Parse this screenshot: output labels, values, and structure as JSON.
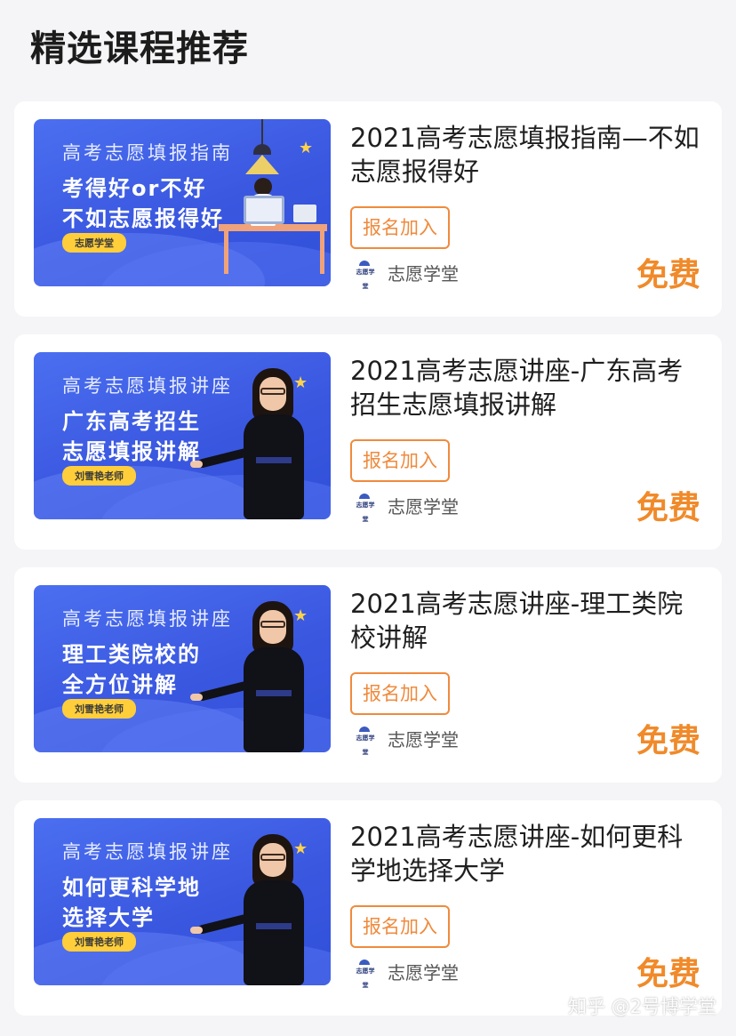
{
  "section_title": "精选课程推荐",
  "courses": [
    {
      "title": "2021高考志愿填报指南—不如志愿报得好",
      "join_label": "报名加入",
      "org_logo_text": "志愿学堂",
      "org_name": "志愿学堂",
      "price": "免费",
      "thumb": {
        "line1": "高考志愿填报指南",
        "line2": "考得好or不好",
        "line3": "不如志愿报得好",
        "tag": "志愿学堂"
      }
    },
    {
      "title": "2021高考志愿讲座-广东高考招生志愿填报讲解",
      "join_label": "报名加入",
      "org_logo_text": "志愿学堂",
      "org_name": "志愿学堂",
      "price": "免费",
      "thumb": {
        "line1": "高考志愿填报讲座",
        "line2": "广东高考招生",
        "line3": "志愿填报讲解",
        "tag": "刘雪艳老师"
      }
    },
    {
      "title": "2021高考志愿讲座-理工类院校讲解",
      "join_label": "报名加入",
      "org_logo_text": "志愿学堂",
      "org_name": "志愿学堂",
      "price": "免费",
      "thumb": {
        "line1": "高考志愿填报讲座",
        "line2": "理工类院校的",
        "line3": "全方位讲解",
        "tag": "刘雪艳老师"
      }
    },
    {
      "title": "2021高考志愿讲座-如何更科学地选择大学",
      "join_label": "报名加入",
      "org_logo_text": "志愿学堂",
      "org_name": "志愿学堂",
      "price": "免费",
      "thumb": {
        "line1": "高考志愿填报讲座",
        "line2": "如何更科学地",
        "line3": "选择大学",
        "tag": "刘雪艳老师"
      }
    }
  ],
  "watermark": "知乎 @2号博学堂",
  "colors": {
    "accent": "#f08a3c",
    "price": "#f08a2a",
    "thumb_bg": "#3a57e0",
    "tag": "#ffce3a"
  }
}
